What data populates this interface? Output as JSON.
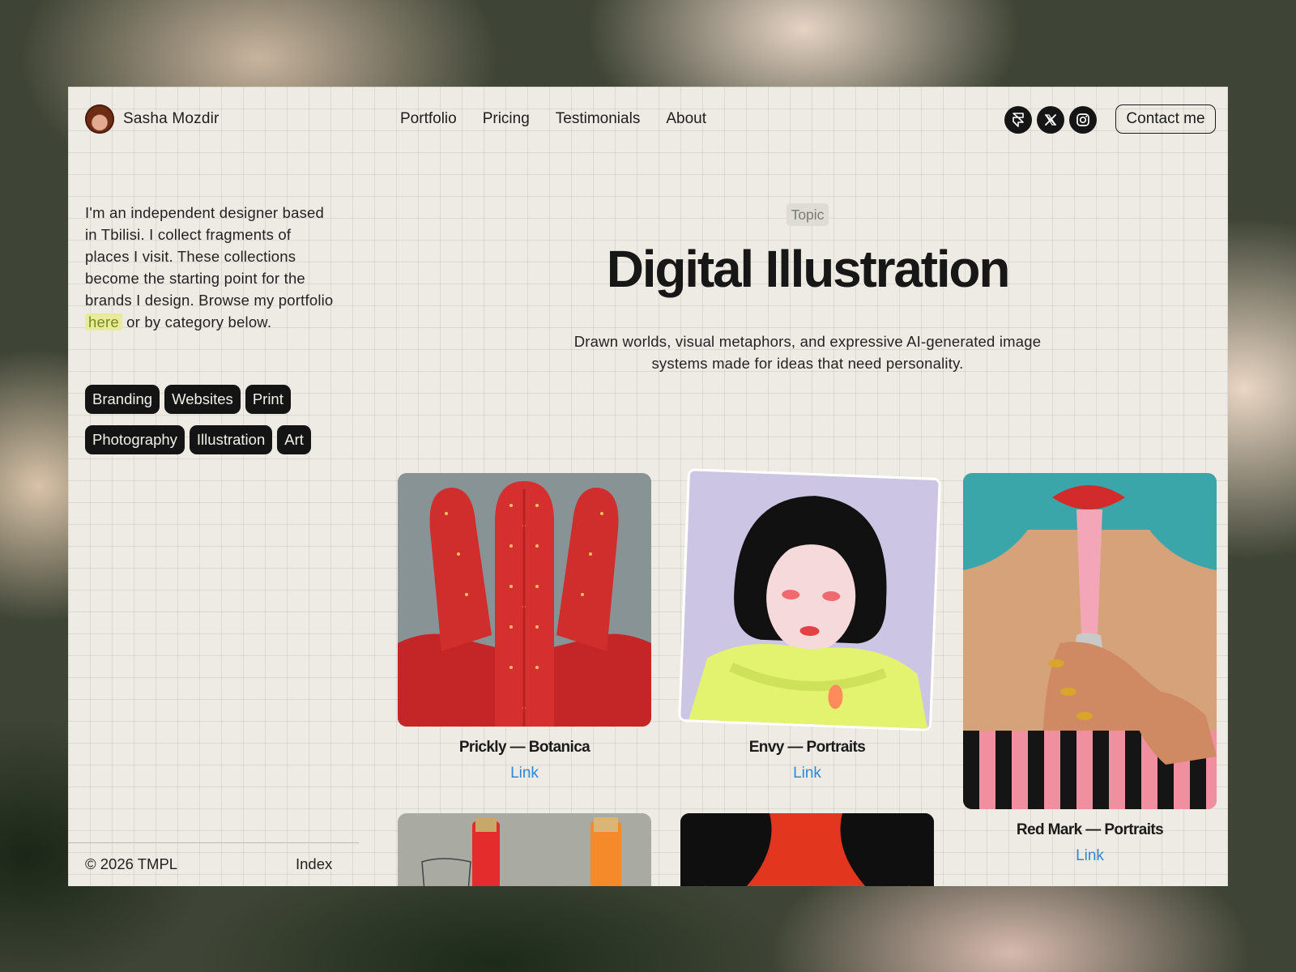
{
  "header": {
    "brand_name": "Sasha Mozdir",
    "nav": [
      "Portfolio",
      "Pricing",
      "Testimonials",
      "About"
    ],
    "socials": [
      "framer-icon",
      "x-icon",
      "instagram-icon"
    ],
    "contact_label": "Contact me"
  },
  "sidebar": {
    "intro_before": "I'm an independent designer based in Tbilisi. I collect fragments of places I visit. These collections become the starting point for the brands I design. Browse my portfolio ",
    "intro_link": "here",
    "intro_after": " or by category below.",
    "tags": [
      "Branding",
      "Websites",
      "Print",
      "Photography",
      "Illustration",
      "Art"
    ],
    "footer": {
      "copyright": "© 2026 TMPL",
      "index_label": "Index"
    }
  },
  "hero": {
    "topic_label": "Topic",
    "title": "Digital Illustration",
    "description": "Drawn worlds, visual metaphors, and expressive AI-generated image systems made for ideas that need personality."
  },
  "works": [
    {
      "caption": "Prickly — Botanica",
      "link_label": "Link"
    },
    {
      "caption": "Envy — Portraits",
      "link_label": "Link"
    },
    {
      "caption": "Red Mark — Portraits",
      "link_label": "Link"
    }
  ],
  "colors": {
    "background": "#edebe3",
    "ink": "#141414",
    "link": "#2f87da",
    "highlight": "#e7eb9a"
  }
}
